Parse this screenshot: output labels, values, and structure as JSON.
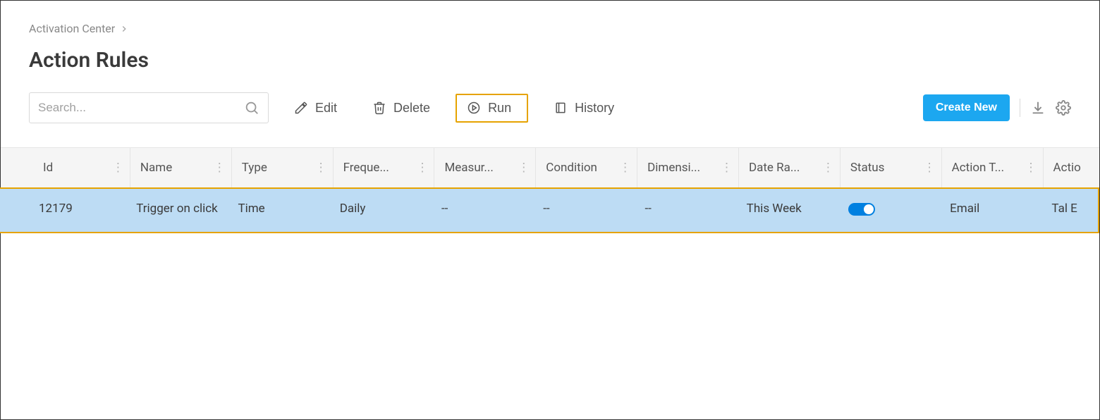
{
  "breadcrumb": {
    "label": "Activation Center"
  },
  "page_title": "Action Rules",
  "search": {
    "placeholder": "Search..."
  },
  "toolbar": {
    "edit": "Edit",
    "delete": "Delete",
    "run": "Run",
    "history": "History",
    "create_new": "Create New"
  },
  "columns": {
    "id": "Id",
    "name": "Name",
    "type": "Type",
    "frequency": "Freque...",
    "measure": "Measur...",
    "condition": "Condition",
    "dimension": "Dimensi...",
    "date_range": "Date Ra...",
    "status": "Status",
    "action_type": "Action T...",
    "action2": "Actio"
  },
  "row": {
    "id": "12179",
    "name": "Trigger on click",
    "type": "Time",
    "frequency": "Daily",
    "measure": "--",
    "condition": "--",
    "dimension": "--",
    "date_range": "This Week",
    "status_on": true,
    "action_type": "Email",
    "action2": "Tal E"
  }
}
